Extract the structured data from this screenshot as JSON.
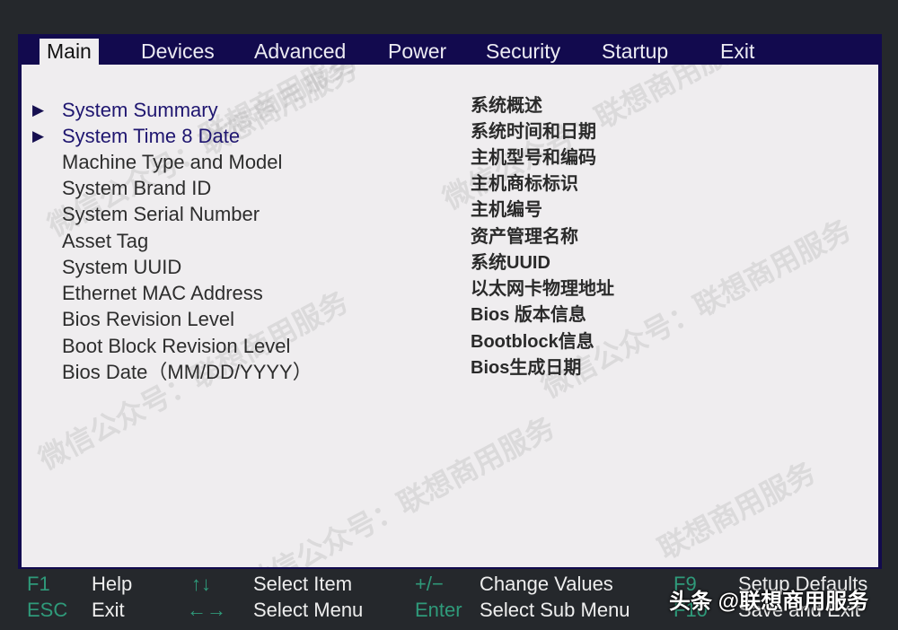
{
  "tabs": [
    {
      "label": "Main",
      "active": true
    },
    {
      "label": "Devices",
      "active": false
    },
    {
      "label": "Advanced",
      "active": false
    },
    {
      "label": "Power",
      "active": false
    },
    {
      "label": "Security",
      "active": false
    },
    {
      "label": "Startup",
      "active": false
    },
    {
      "label": "Exit",
      "active": false
    }
  ],
  "items": [
    {
      "label": "System Summary",
      "submenu": true,
      "desc": "系统概述"
    },
    {
      "label": "System Time 8 Date",
      "submenu": true,
      "desc": "系统时间和日期"
    },
    {
      "label": "Machine Type and Model",
      "submenu": false,
      "desc": "主机型号和编码"
    },
    {
      "label": "System Brand ID",
      "submenu": false,
      "desc": "主机商标标识"
    },
    {
      "label": "System Serial Number",
      "submenu": false,
      "desc": "主机编号"
    },
    {
      "label": "Asset Tag",
      "submenu": false,
      "desc": "资产管理名称"
    },
    {
      "label": "System UUID",
      "submenu": false,
      "desc": "系统UUID"
    },
    {
      "label": "Ethernet MAC Address",
      "submenu": false,
      "desc": "以太网卡物理地址"
    },
    {
      "label": "Bios Revision Level",
      "submenu": false,
      "desc": "Bios 版本信息"
    },
    {
      "label": "Boot Block Revision Level",
      "submenu": false,
      "desc": "Bootblock信息"
    },
    {
      "label": "Bios Date（MM/DD/YYYY）",
      "submenu": false,
      "desc": "Bios生成日期"
    }
  ],
  "arrow_glyph": "▶",
  "footer": {
    "row1": [
      {
        "key": "F1",
        "label": "Help"
      },
      {
        "key": "↑↓",
        "label": "Select Item"
      },
      {
        "key": "+/−",
        "label": "Change Values"
      },
      {
        "key": "F9",
        "label": "Setup Defaults"
      }
    ],
    "row2": [
      {
        "key": "ESC",
        "label": "Exit"
      },
      {
        "key": "←→",
        "label": "Select Menu"
      },
      {
        "key": "Enter",
        "label": "Select Sub Menu"
      },
      {
        "key": "F10",
        "label": "Save and Exit"
      }
    ]
  },
  "watermarks": {
    "brand": "联想商用服务",
    "account": "微信公众号：联想商用服务",
    "toutiao": "头条 @联想商用服务"
  },
  "colors": {
    "frame": "#120a4e",
    "panel": "#efedef",
    "background": "#25282c",
    "key": "#2f9a7a",
    "submenu_text": "#1f1670"
  }
}
